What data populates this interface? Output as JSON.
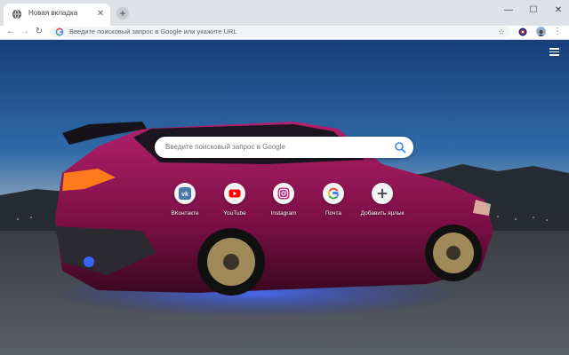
{
  "tab": {
    "title": "Новая вкладка",
    "close_glyph": "✕",
    "favicon": "globe-icon"
  },
  "newtab": {
    "glyph": "+"
  },
  "window": {
    "minimize": "—",
    "maximize": "☐",
    "close": "✕"
  },
  "toolbar": {
    "back": "←",
    "forward": "→",
    "reload": "↻",
    "omnibox_placeholder": "Введите поисковый запрос в Google или укажите URL",
    "star": "☆",
    "menu": "⋮"
  },
  "search": {
    "placeholder": "Введите поисковый запрос в Google"
  },
  "shortcuts": [
    {
      "label": "ВКонтакте",
      "icon": "vk-icon",
      "color": "#4a76a8"
    },
    {
      "label": "YouTube",
      "icon": "youtube-icon",
      "color": "#ff0000"
    },
    {
      "label": "Instagram",
      "icon": "instagram-icon",
      "color": "#c13584"
    },
    {
      "label": "Почта",
      "icon": "google-icon",
      "color": "#4285f4"
    },
    {
      "label": "Добавить ярлык",
      "icon": "plus-icon",
      "color": "#3c4043"
    }
  ],
  "colors": {
    "sky_top": "#1c4b86",
    "sky_horizon": "#e3a06a",
    "car_body": "#8a1250",
    "underglow": "#3a5cff"
  }
}
